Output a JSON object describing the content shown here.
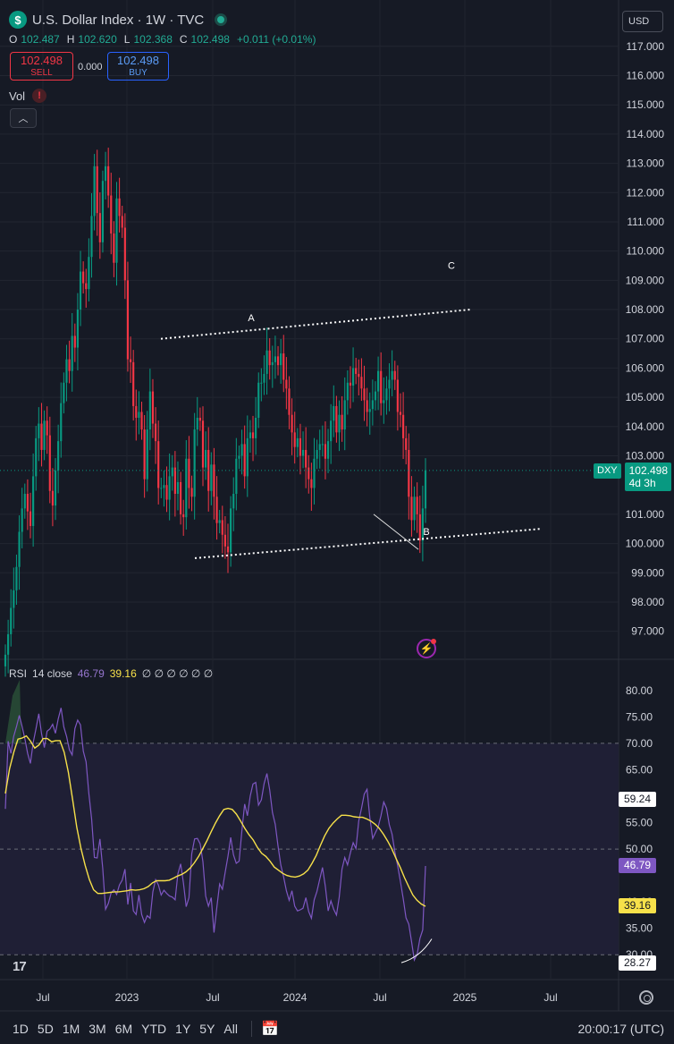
{
  "header": {
    "symbol_badge": "$",
    "title": "U.S. Dollar Index · 1W · TVC",
    "currency": "USD",
    "ohlc": [
      {
        "k": "O",
        "v": "102.487"
      },
      {
        "k": "H",
        "v": "102.620"
      },
      {
        "k": "L",
        "v": "102.368"
      },
      {
        "k": "C",
        "v": "102.498"
      }
    ],
    "change": "+0.011 (+0.01%)",
    "sell": {
      "price": "102.498",
      "label": "SELL"
    },
    "spread": "0.000",
    "buy": {
      "price": "102.498",
      "label": "BUY"
    },
    "vol_label": "Vol",
    "vol_warning": "!"
  },
  "price_pane": {
    "symbol_tag": "DXY",
    "last_price": "102.498",
    "countdown": "4d 3h",
    "annotations": [
      "A",
      "B",
      "C"
    ]
  },
  "rsi_pane": {
    "label": "RSI",
    "params": "14 close",
    "rsi_value": "46.79",
    "ma_value": "39.16",
    "extra": "∅ ∅ ∅ ∅ ∅ ∅",
    "tags": [
      {
        "text": "59.24",
        "value": 59.24,
        "style": "plain"
      },
      {
        "text": "46.79",
        "value": 46.79,
        "style": "rsi"
      },
      {
        "text": "39.16",
        "value": 39.16,
        "style": "ma"
      },
      {
        "text": "28.27",
        "value": 28.27,
        "style": "plain"
      }
    ]
  },
  "bottom_bar": {
    "timeframes": [
      "1D",
      "5D",
      "1M",
      "3M",
      "6M",
      "YTD",
      "1Y",
      "5Y",
      "All"
    ],
    "clock": "20:00:17 (UTC)"
  },
  "colors": {
    "up": "#089981",
    "down": "#f23645",
    "rsi": "#7e57c2",
    "rsi_ma": "#f7e14a",
    "background": "#161a25"
  },
  "chart_data": [
    {
      "type": "candlestick",
      "title": "U.S. Dollar Index · 1W · TVC",
      "ylim": [
        96.5,
        117.3
      ],
      "y_ticks": [
        "117.000",
        "116.000",
        "115.000",
        "114.000",
        "113.000",
        "112.000",
        "111.000",
        "110.000",
        "109.000",
        "108.000",
        "107.000",
        "106.000",
        "105.000",
        "104.000",
        "103.000",
        "101.000",
        "100.000",
        "99.000",
        "98.000",
        "97.000"
      ],
      "x_ticks": [
        "Jul",
        "2023",
        "Jul",
        "2024",
        "Jul",
        "2025",
        "Jul"
      ],
      "grid": true,
      "series": [
        {
          "name": "DXY",
          "closes": [
            96.2,
            96.9,
            97.8,
            98.4,
            99.2,
            100.4,
            101.2,
            101.7,
            101.1,
            100.6,
            102.3,
            103.6,
            104.1,
            103.2,
            104.2,
            103.7,
            101.8,
            101.3,
            102.5,
            103.5,
            104.8,
            105.5,
            106.3,
            105.9,
            107.1,
            106.7,
            108.0,
            109.3,
            108.9,
            108.7,
            109.8,
            111.2,
            112.9,
            111.3,
            110.3,
            112.4,
            112.9,
            111.9,
            110.6,
            109.6,
            111.8,
            111.2,
            110.8,
            109.0,
            106.3,
            106.2,
            104.7,
            104.3,
            104.5,
            103.9,
            102.2,
            103.9,
            105.2,
            104.1,
            103.5,
            101.9,
            101.9,
            102.0,
            101.5,
            102.3,
            102.6,
            101.7,
            102.1,
            101.0,
            100.9,
            102.9,
            101.9,
            101.6,
            103.9,
            104.3,
            104.2,
            102.6,
            103.2,
            101.8,
            102.7,
            101.6,
            100.7,
            100.8,
            100.3,
            99.9,
            99.7,
            101.2,
            101.7,
            102.9,
            103.0,
            103.4,
            102.3,
            103.6,
            103.8,
            103.6,
            104.3,
            105.5,
            105.5,
            105.8,
            106.6,
            106.1,
            106.2,
            106.4,
            106.1,
            106.5,
            105.6,
            105.3,
            104.4,
            103.8,
            103.3,
            103.6,
            103.0,
            103.2,
            102.6,
            102.2,
            101.9,
            102.9,
            103.2,
            103.4,
            103.4,
            102.9,
            103.5,
            104.2,
            104.7,
            103.8,
            104.4,
            103.9,
            104.9,
            105.5,
            105.4,
            106.0,
            105.8,
            105.7,
            105.3,
            104.9,
            104.5,
            104.6,
            104.9,
            105.2,
            105.9,
            104.8,
            104.9,
            105.3,
            105.6,
            105.9,
            105.6,
            104.5,
            104.4,
            103.6,
            103.2,
            101.6,
            100.8,
            101.6,
            101.0,
            100.1,
            101.2,
            102.5
          ]
        },
        {
          "name": "Trendline A-C",
          "x": [
            "A-line start",
            "C-line end"
          ],
          "y": [
            107.0,
            108.0
          ]
        },
        {
          "name": "Trendline B",
          "x": [
            "B-line start",
            "B-line end"
          ],
          "y": [
            99.5,
            100.5
          ]
        }
      ],
      "annotations": [
        "A",
        "B",
        "C"
      ],
      "last": 102.498
    },
    {
      "type": "line",
      "title": "RSI 14 close",
      "ylim": [
        27.5,
        82.0
      ],
      "y_ticks": [
        "80.00",
        "75.00",
        "70.00",
        "65.00",
        "55.00",
        "50.00",
        "40.00",
        "35.00",
        "30.00"
      ],
      "bands": [
        70,
        50,
        30
      ],
      "series": [
        {
          "name": "RSI",
          "values": [
            57.6,
            70.4,
            68.1,
            71.3,
            73.2,
            75.3,
            73.2,
            70.9,
            68.1,
            66.2,
            70.1,
            72.7,
            75.6,
            71.8,
            69.2,
            72.3,
            72.7,
            73.6,
            71.9,
            74.6,
            76.7,
            73.1,
            71.3,
            68.8,
            67.8,
            72.8,
            74.4,
            73.5,
            68.5,
            66.5,
            60.5,
            55.7,
            48.4,
            48.3,
            51.9,
            46.4,
            38.6,
            39.7,
            41.7,
            42.3,
            41.4,
            43.2,
            44.1,
            46.2,
            39.5,
            43.6,
            38.3,
            37.6,
            41.3,
            37.6,
            36.1,
            37.4,
            36.9,
            41.9,
            44.2,
            43.2,
            41.3,
            42.2,
            41.6,
            41.1,
            40.9,
            40.4,
            45.3,
            47.2,
            43.6,
            39.1,
            40.8,
            49.1,
            51.9,
            52.0,
            51.0,
            47.6,
            41.1,
            39.2,
            40.8,
            34.2,
            39.0,
            43.4,
            42.4,
            45.6,
            48.6,
            52.2,
            48.9,
            47.3,
            47.7,
            53.5,
            58.5,
            56.3,
            60.0,
            62.3,
            62.6,
            58.3,
            59.3,
            62.4,
            64.3,
            61.2,
            56.9,
            54.7,
            50.6,
            47.0,
            44.7,
            42.1,
            40.3,
            42.1,
            39.2,
            38.3,
            38.5,
            38.8,
            40.8,
            38.2,
            36.9,
            40.4,
            42.0,
            44.3,
            46.5,
            43.0,
            38.3,
            40.2,
            38.6,
            37.5,
            40.9,
            46.2,
            48.4,
            47.0,
            49.3,
            51.2,
            50.1,
            55.3,
            57.7,
            60.4,
            61.3,
            56.0,
            52.0,
            53.1,
            54.2,
            56.3,
            58.9,
            57.7,
            54.6,
            52.8,
            49.4,
            46.8,
            43.8,
            40.6,
            37.0,
            35.8,
            32.5,
            29.0,
            30.1,
            33.1,
            34.7,
            46.79
          ]
        },
        {
          "name": "RSI-based MA",
          "values": [
            60.5,
            65.2,
            68.3,
            70.8,
            71.0,
            71.4,
            70.4,
            69.1,
            69.7,
            70.9,
            70.9,
            70.3,
            70.5,
            70.5,
            68.3,
            64.5,
            59.4,
            54.1,
            50.1,
            46.9,
            44.2,
            42.3,
            41.6,
            41.6,
            41.7,
            41.8,
            41.9,
            41.9,
            42.0,
            42.1,
            42.3,
            42.2,
            42.3,
            42.5,
            42.9,
            43.6,
            44.0,
            44.0,
            44.0,
            44.1,
            44.5,
            44.9,
            45.2,
            45.7,
            46.4,
            47.4,
            48.6,
            50.1,
            51.6,
            53.3,
            54.9,
            56.3,
            57.5,
            57.7,
            57.5,
            56.6,
            55.3,
            53.9,
            52.7,
            51.7,
            50.3,
            49.2,
            48.6,
            47.7,
            46.6,
            46.0,
            45.4,
            45.0,
            44.8,
            44.7,
            44.9,
            45.3,
            46.0,
            47.3,
            48.8,
            50.7,
            52.5,
            53.9,
            54.9,
            55.7,
            56.4,
            56.4,
            56.3,
            56.1,
            56.0,
            56.0,
            55.7,
            55.3,
            54.7,
            53.9,
            52.8,
            51.5,
            50.0,
            48.2,
            46.5,
            44.6,
            42.9,
            41.3,
            40.3,
            39.6,
            39.16
          ]
        }
      ],
      "last": {
        "rsi": 46.79,
        "ma": 39.16
      },
      "markers": [
        59.24,
        28.27
      ]
    }
  ]
}
